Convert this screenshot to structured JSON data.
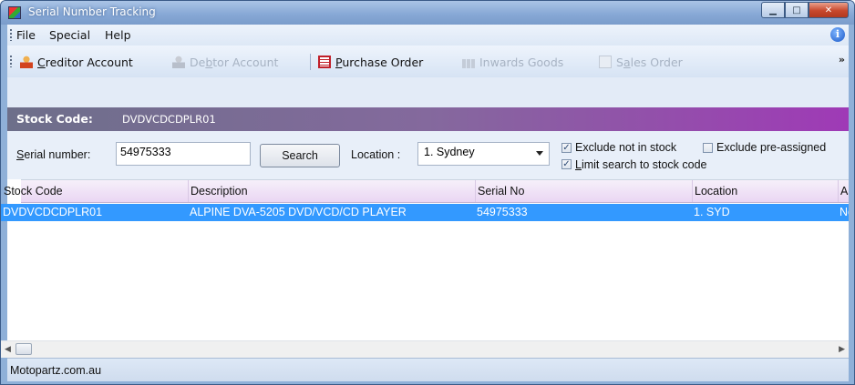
{
  "window": {
    "title": "Serial Number Tracking"
  },
  "menu": {
    "items": [
      "File",
      "Special",
      "Help"
    ]
  },
  "toolbar": {
    "creditor_account": {
      "pre": "",
      "key": "C",
      "post": "reditor Account"
    },
    "debtor_account": {
      "pre": "De",
      "key": "b",
      "post": "tor Account"
    },
    "purchase_order": {
      "pre": "",
      "key": "P",
      "post": "urchase Order"
    },
    "inwards_goods": "Inwards Goods",
    "sales_order": {
      "pre": "S",
      "key": "a",
      "post": "les Order"
    }
  },
  "stock": {
    "label": "Stock Code:",
    "value": "DVDVCDCDPLR01"
  },
  "search": {
    "serial_label_key": "S",
    "serial_label_rest": "erial number:",
    "serial_value": "54975333",
    "search_button": "Search",
    "location_label": "Location :",
    "location_value": "1. Sydney",
    "exclude_not_in_stock": {
      "label": "Exclude not in stock",
      "checked": true
    },
    "exclude_pre_assigned": {
      "label": "Exclude pre-assigned",
      "checked": false
    },
    "limit_search": {
      "label_key": "L",
      "label_rest": "imit search to stock code",
      "checked": true
    }
  },
  "grid": {
    "columns": [
      "Stock Code",
      "Description",
      "Serial No",
      "Location",
      "As"
    ],
    "rows": [
      {
        "stock_code": "DVDVCDCDPLR01",
        "description": "ALPINE DVA-5205 DVD/VCD/CD PLAYER",
        "serial_no": "54975333",
        "location": "1. SYD",
        "as": "No"
      }
    ]
  },
  "status": {
    "text": "Motopartz.com.au"
  },
  "icons": {
    "app": "serial-tracking-app-icon",
    "info": "info-icon",
    "more": "toolbar-overflow-chevron-icon"
  },
  "colors": {
    "selection": "#3399ff",
    "stock_bar_start": "#6d6f8a",
    "stock_bar_end": "#9f3ab6",
    "grid_header": "#ead6f3"
  }
}
